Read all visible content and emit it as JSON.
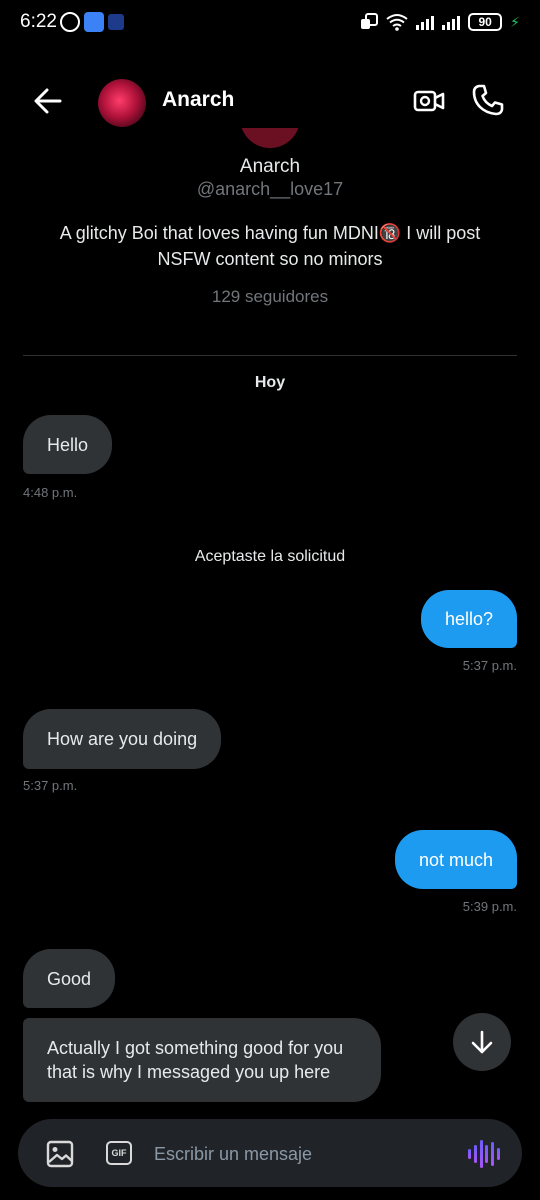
{
  "status_bar": {
    "time": "6:22",
    "battery": "90"
  },
  "header": {
    "name": "Anarch"
  },
  "profile": {
    "name": "Anarch",
    "handle": "@anarch__love17",
    "bio": "A glitchy Boi that loves having fun MDNI🔞 I will post NSFW content so no minors",
    "followers": "129 seguidores"
  },
  "date_separator": "Hoy",
  "messages": [
    {
      "direction": "in",
      "text": "Hello",
      "time": "4:48 p.m."
    },
    {
      "direction": "system",
      "text": "Aceptaste la solicitud"
    },
    {
      "direction": "out",
      "text": "hello?",
      "time": "5:37 p.m."
    },
    {
      "direction": "in",
      "text": "How are you doing",
      "time": "5:37 p.m."
    },
    {
      "direction": "out",
      "text": "not much",
      "time": "5:39 p.m."
    },
    {
      "direction": "in",
      "text": "Good"
    },
    {
      "direction": "in",
      "text": "Actually I got something good for you that is why I messaged you up here"
    }
  ],
  "composer": {
    "placeholder": "Escribir un mensaje",
    "gif_label": "GIF"
  },
  "colors": {
    "accent": "#1d9bf0",
    "incoming_bubble": "#2f3336",
    "background": "#000000"
  }
}
